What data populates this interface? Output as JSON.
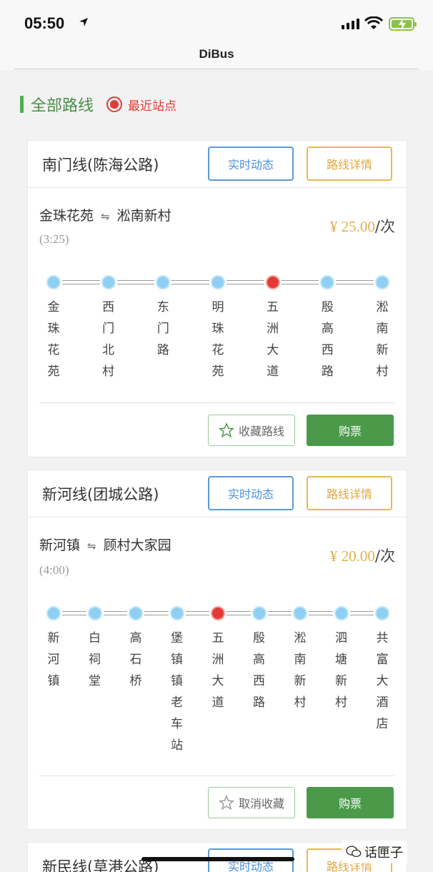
{
  "status_bar": {
    "time": "05:50"
  },
  "nav": {
    "title": "DiBus"
  },
  "section": {
    "title": "全部路线",
    "nearby_label": "最近站点"
  },
  "routes": [
    {
      "name": "南门线(陈海公路)",
      "live_label": "实时动态",
      "detail_label": "路线详情",
      "from": "金珠花苑",
      "to": "淞南新村",
      "duration": "(3:25)",
      "price": "¥ 25.00",
      "price_unit": "/次",
      "stops": [
        "金珠花苑",
        "西门北村",
        "东门路",
        "明珠花苑",
        "五洲大道",
        "殷高西路",
        "淞南新村"
      ],
      "current_stop_index": 4,
      "fav_label": "收藏路线",
      "buy_label": "购票"
    },
    {
      "name": "新河线(团城公路)",
      "live_label": "实时动态",
      "detail_label": "路线详情",
      "from": "新河镇",
      "to": "顾村大家园",
      "duration": "(4:00)",
      "price": "¥ 20.00",
      "price_unit": "/次",
      "stops": [
        "新河镇",
        "白祠堂",
        "高石桥",
        "堡镇镇老车站",
        "五洲大道",
        "殷高西路",
        "淞南新村",
        "泗塘新村",
        "共富大酒店"
      ],
      "current_stop_index": 4,
      "fav_label": "取消收藏",
      "buy_label": "购票"
    },
    {
      "name": "新民线(草港公路)",
      "live_label": "实时动态",
      "detail_label": "路线详情"
    }
  ],
  "watermark": {
    "text": "话匣子"
  },
  "colors": {
    "accent_green": "#4a9a4a",
    "live_blue": "#4a90d9",
    "detail_orange": "#e0a840",
    "current_red": "#e53935"
  }
}
